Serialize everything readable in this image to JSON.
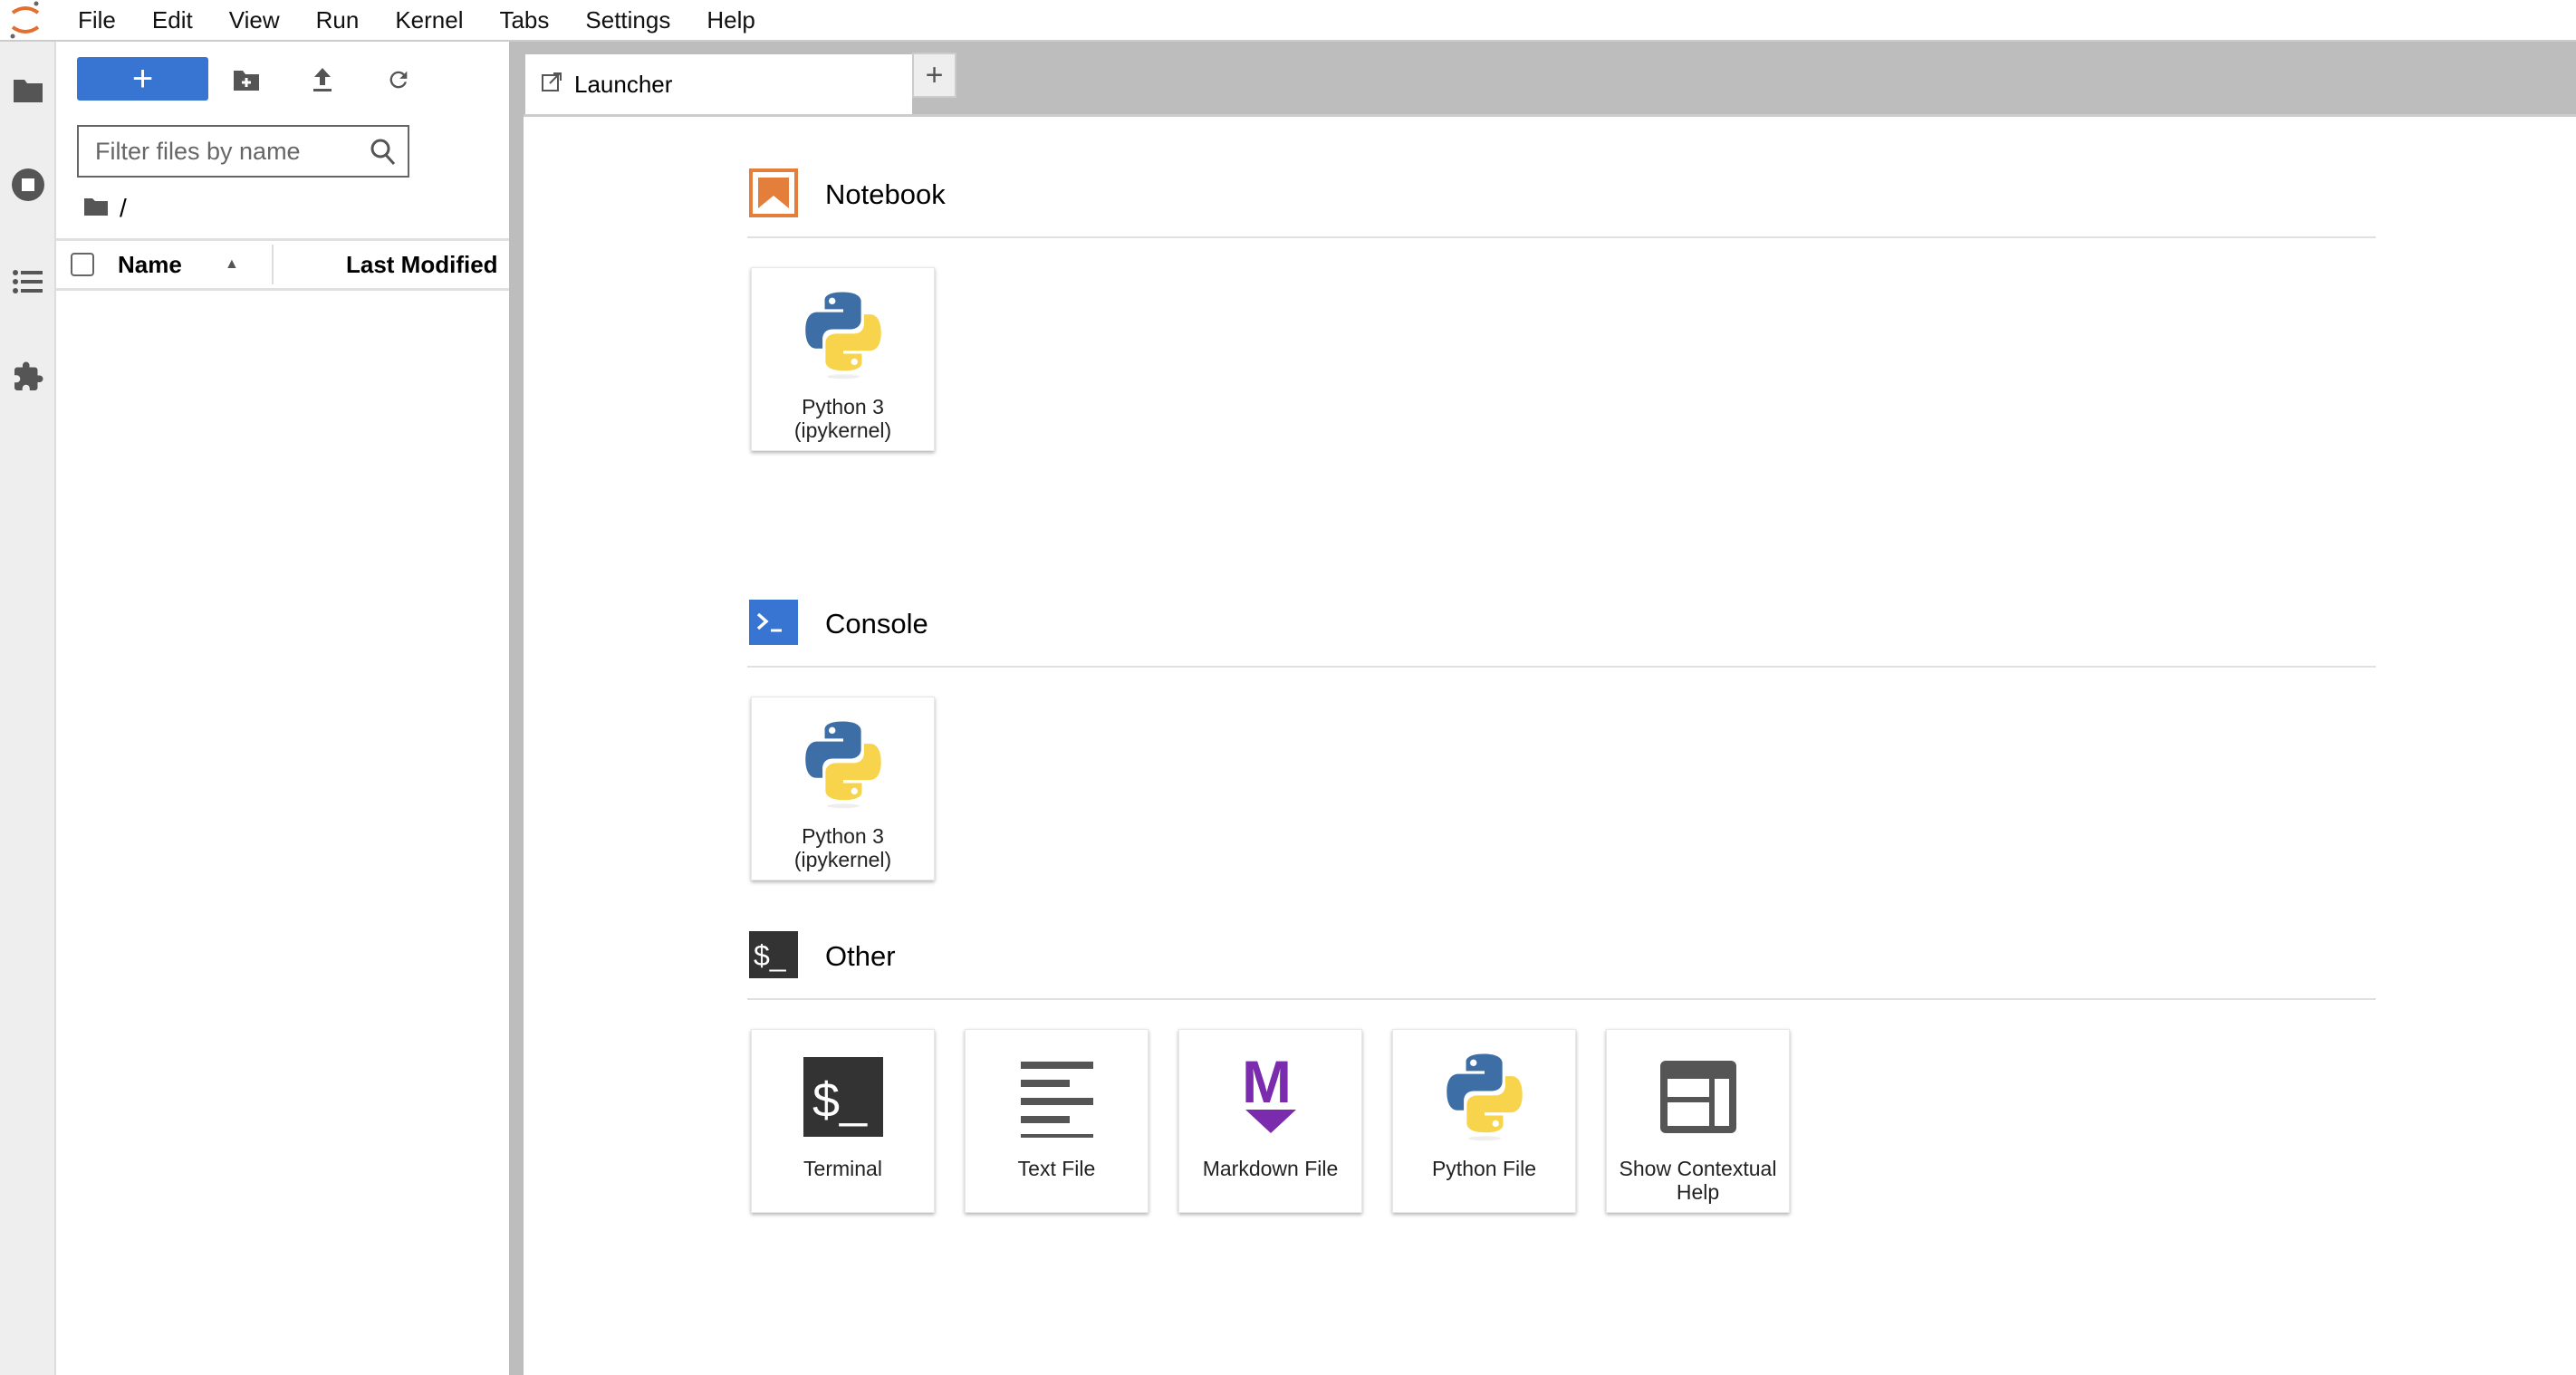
{
  "menubar": {
    "items": [
      "File",
      "Edit",
      "View",
      "Run",
      "Kernel",
      "Tabs",
      "Settings",
      "Help"
    ]
  },
  "filebrowser": {
    "new_label": "+",
    "filter_placeholder": "Filter files by name",
    "breadcrumb": "/",
    "columns": {
      "name": "Name",
      "modified": "Last Modified"
    }
  },
  "tabs": [
    {
      "label": "Launcher"
    }
  ],
  "add_tab_label": "+",
  "launcher": {
    "sections": [
      {
        "title": "Notebook",
        "icon": "notebook-icon",
        "items": [
          {
            "label": "Python 3 (ipykernel)",
            "icon": "python-icon"
          }
        ]
      },
      {
        "title": "Console",
        "icon": "console-icon",
        "items": [
          {
            "label": "Python 3 (ipykernel)",
            "icon": "python-icon"
          }
        ]
      },
      {
        "title": "Other",
        "icon": "terminal-icon",
        "items": [
          {
            "label": "Terminal",
            "icon": "terminal-icon"
          },
          {
            "label": "Text File",
            "icon": "text-file-icon"
          },
          {
            "label": "Markdown File",
            "icon": "markdown-icon"
          },
          {
            "label": "Python File",
            "icon": "python-icon"
          },
          {
            "label": "Show Contextual Help",
            "icon": "help-panel-icon"
          }
        ]
      }
    ]
  },
  "colors": {
    "accent": "#3874d1",
    "notebook": "#e47f3b",
    "markdown": "#7b2bad",
    "terminal": "#333333"
  }
}
